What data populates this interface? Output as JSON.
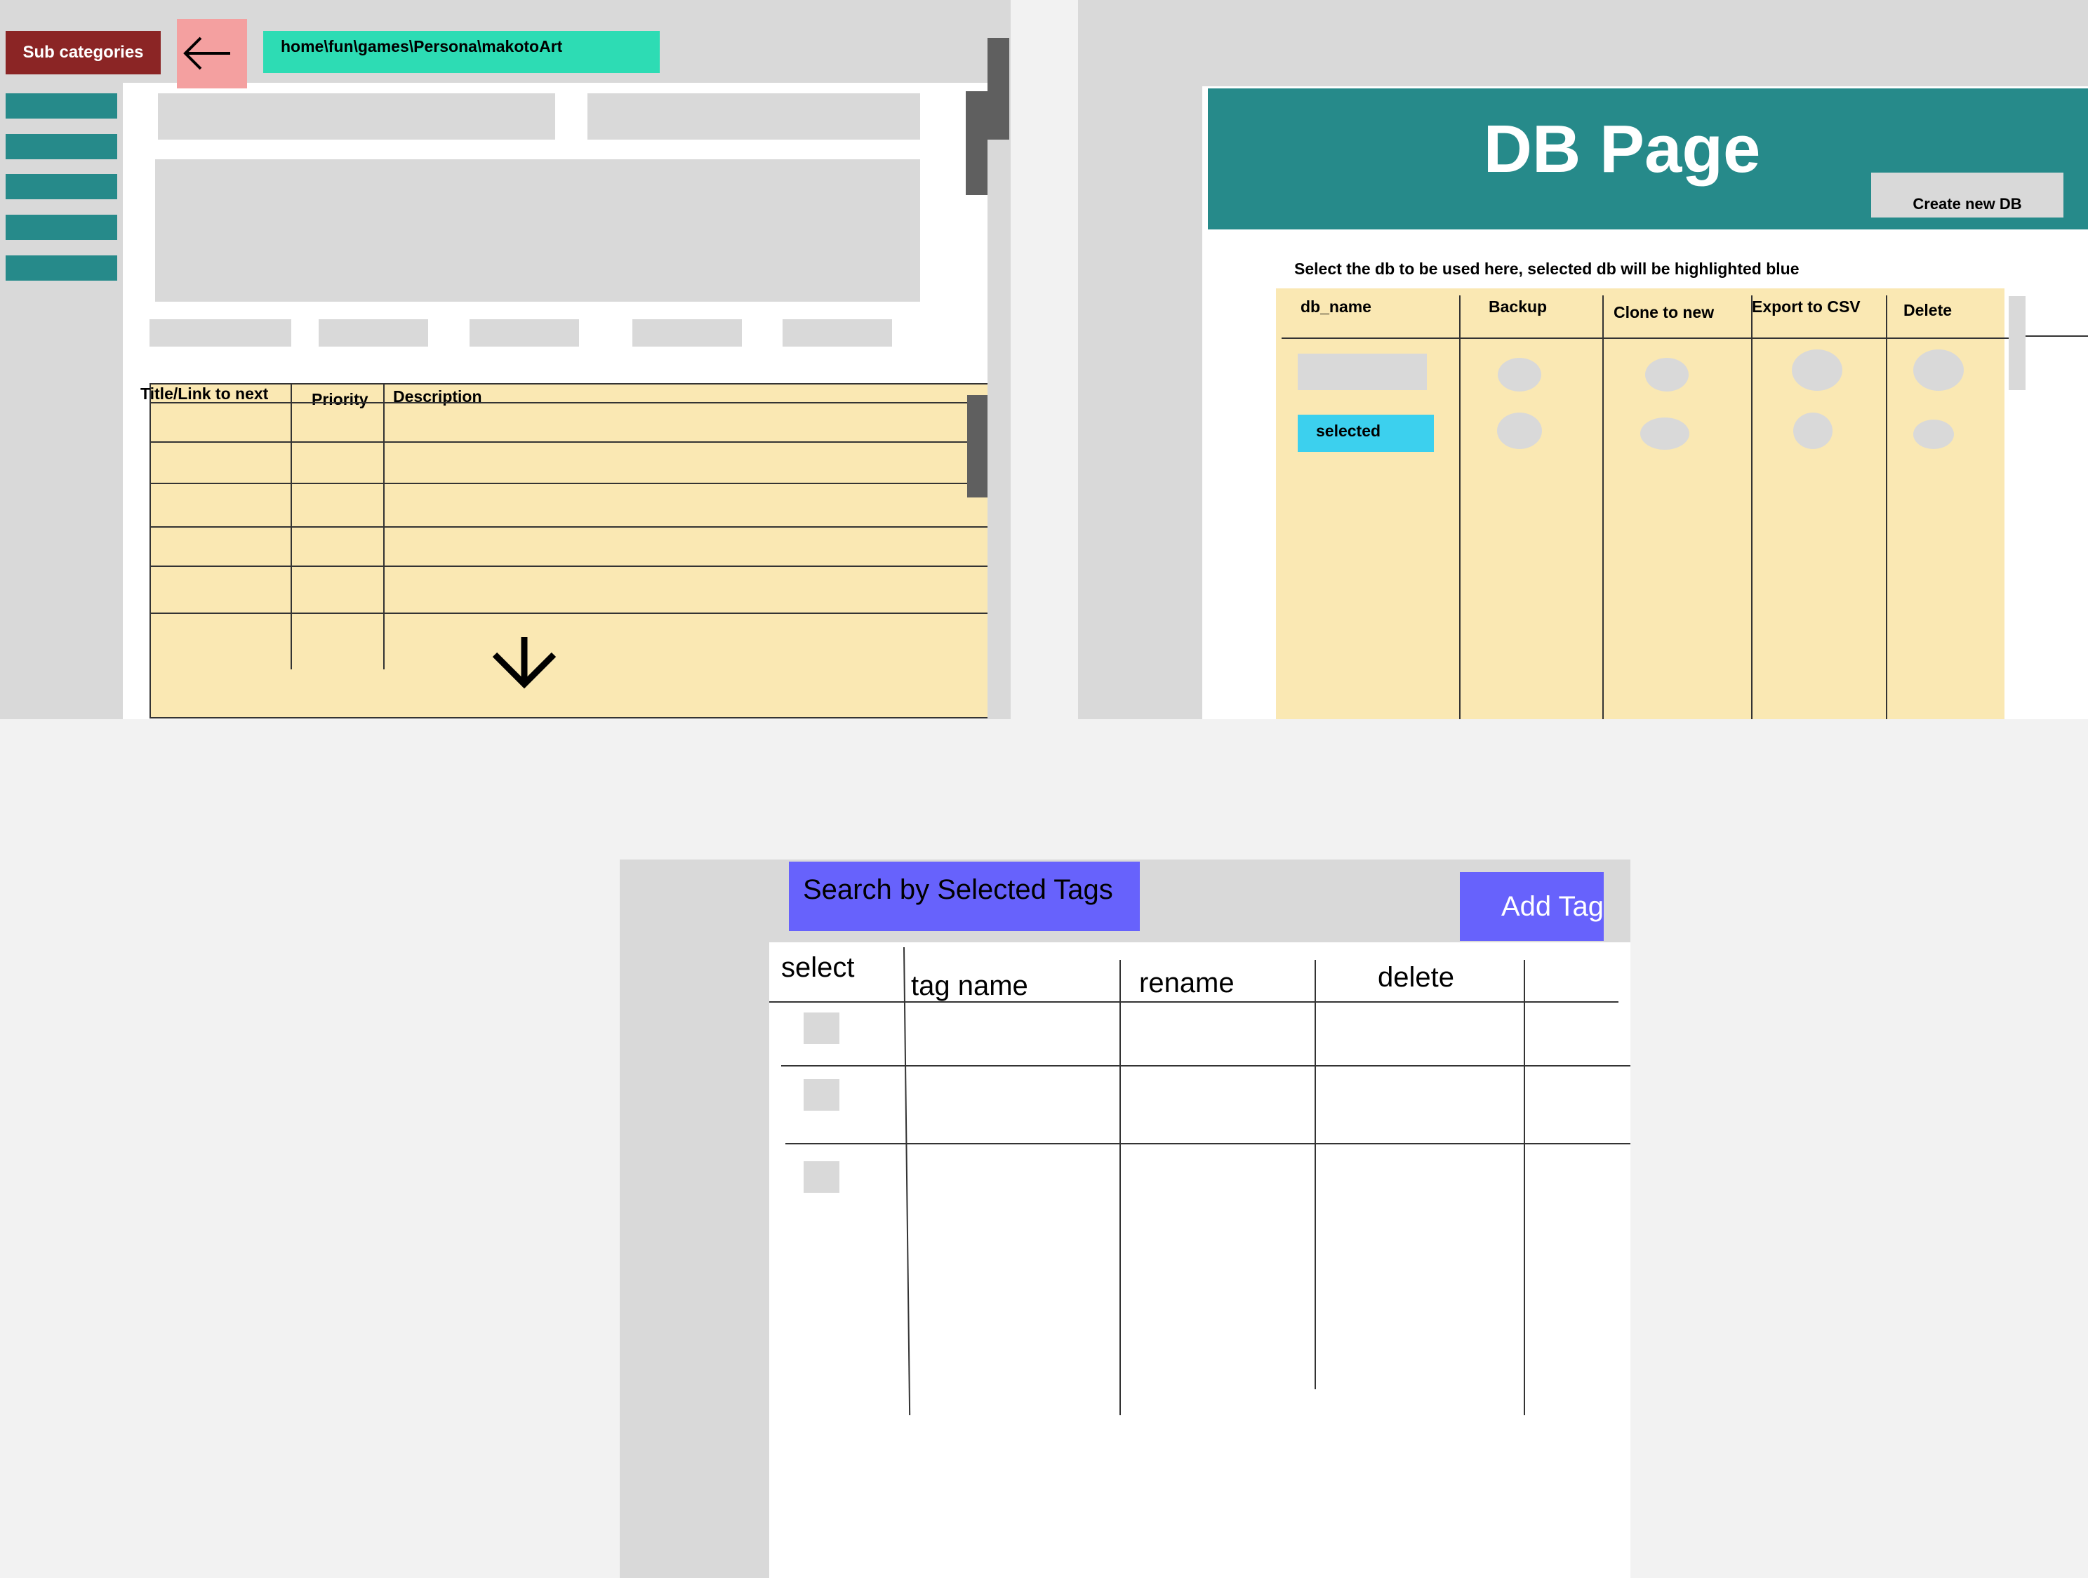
{
  "panel1": {
    "subcategories_label": "Sub categories",
    "path_text": "home\\fun\\games\\Persona\\makotoArt",
    "sidebar_item_count": 5,
    "table": {
      "headers": [
        "Title/Link to next",
        "Priority",
        "Description"
      ]
    }
  },
  "panel2": {
    "title": "DB Page",
    "create_label": "Create new DB",
    "instruction": "Select the db to be used here, selected db will be highlighted blue",
    "headers": [
      "db_name",
      "Backup",
      "Clone to new",
      "Export to CSV",
      "Delete"
    ],
    "selected_label": "selected"
  },
  "panel3": {
    "search_label": "Search by Selected Tags",
    "add_tag_label": "Add Tag",
    "headers": [
      "select",
      "tag name",
      "rename",
      "delete"
    ]
  },
  "colors": {
    "teal": "#268a8a",
    "dark_red": "#8b2525",
    "pink": "#f4a0a0",
    "mint": "#2ddcb4",
    "cyan": "#3cd0ee",
    "purple": "#6762fc",
    "yellow": "#fae8b3",
    "gray": "#d9d9d9"
  },
  "icons": {
    "back": "arrow-left-icon",
    "down": "chevron-down-icon"
  }
}
